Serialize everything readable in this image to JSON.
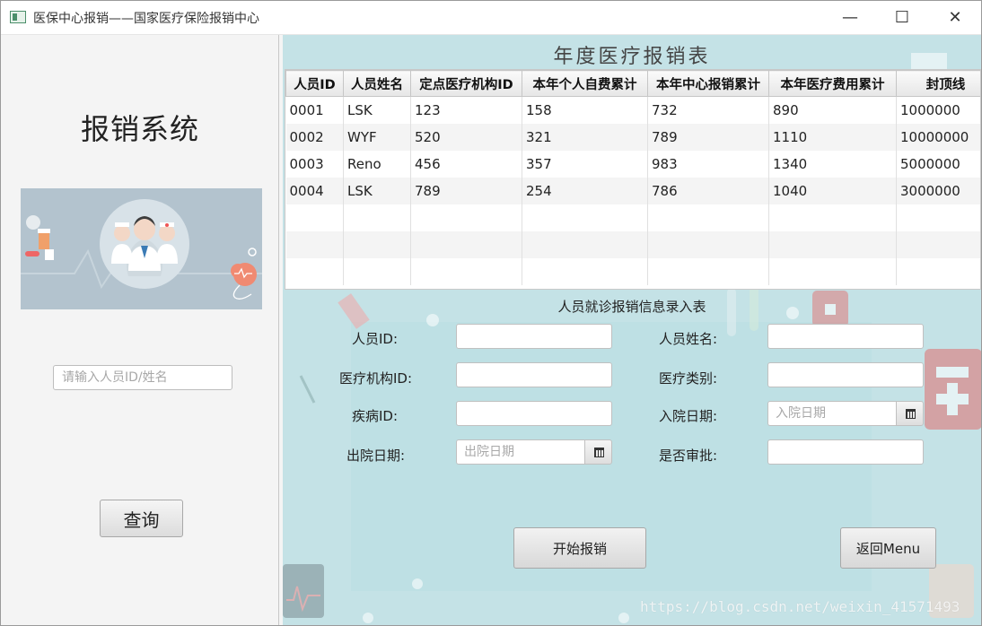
{
  "window": {
    "title": "医保中心报销——国家医疗保险报销中心",
    "min_glyph": "—",
    "max_glyph": "☐",
    "close_glyph": "✕"
  },
  "left": {
    "system_title": "报销系统",
    "search_placeholder": "请输入人员ID/姓名",
    "search_value": "",
    "query_label": "查询"
  },
  "table": {
    "title": "年度医疗报销表",
    "columns": [
      "人员ID",
      "人员姓名",
      "定点医疗机构ID",
      "本年个人自费累计",
      "本年中心报销累计",
      "本年医疗费用累计",
      "封顶线"
    ],
    "rows": [
      [
        "0001",
        "LSK",
        "123",
        "158",
        "732",
        "890",
        "1000000"
      ],
      [
        "0002",
        "WYF",
        "520",
        "321",
        "789",
        "1110",
        "10000000"
      ],
      [
        "0003",
        "Reno",
        "456",
        "357",
        "983",
        "1340",
        "5000000"
      ],
      [
        "0004",
        "LSK",
        "789",
        "254",
        "786",
        "1040",
        "3000000"
      ]
    ],
    "scroll_left": "‹",
    "scroll_right": "›"
  },
  "form": {
    "title": "人员就诊报销信息录入表",
    "person_id_label": "人员ID:",
    "person_name_label": "人员姓名:",
    "institution_id_label": "医疗机构ID:",
    "medical_type_label": "医疗类别:",
    "disease_id_label": "疾病ID:",
    "admission_date_label": "入院日期:",
    "admission_date_placeholder": "入院日期",
    "discharge_date_label": "出院日期:",
    "discharge_date_placeholder": "出院日期",
    "approval_label": "是否审批:",
    "start_button": "开始报销",
    "back_button": "返回Menu"
  },
  "watermark": "https://blog.csdn.net/weixin_41571493",
  "colors": {
    "right_bg": "#c4e2e6",
    "hero_bg": "#b3c3ce"
  }
}
